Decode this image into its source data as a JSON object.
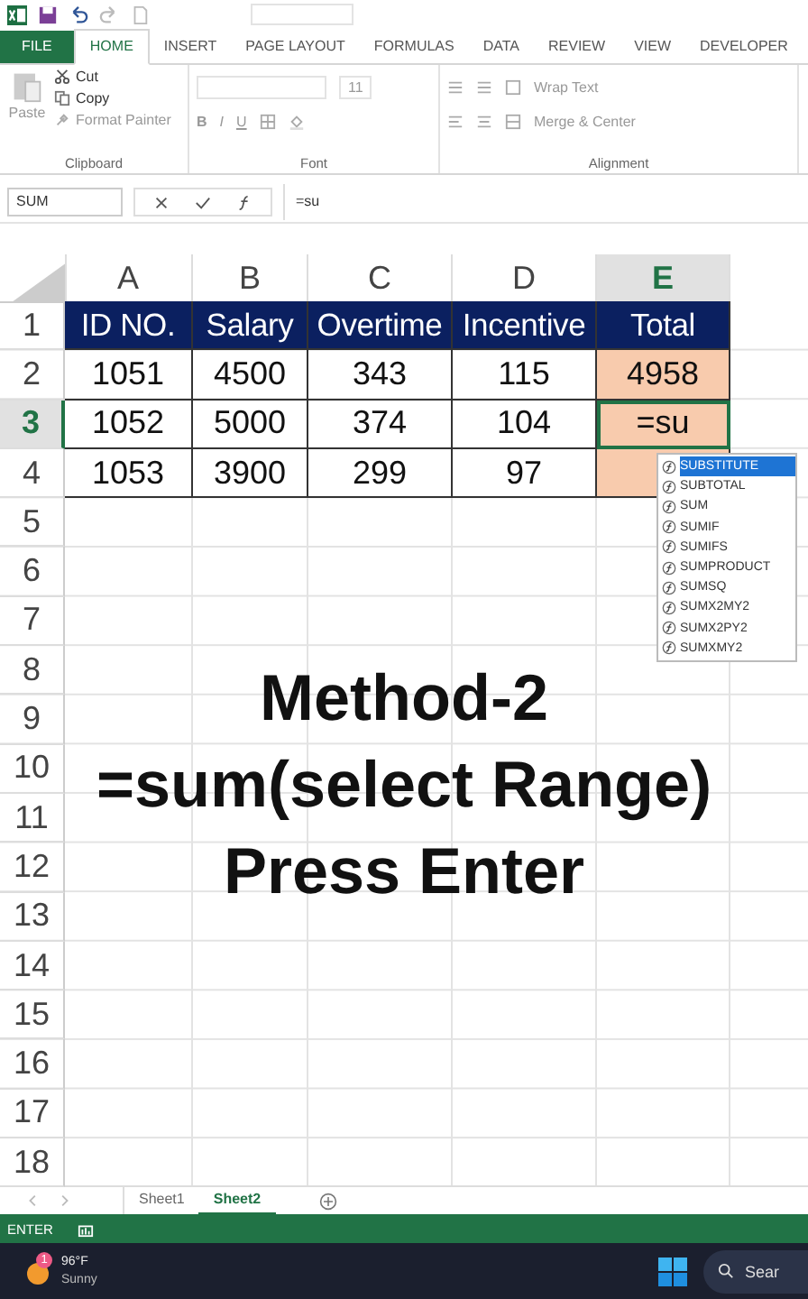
{
  "ribbon_tabs": [
    {
      "label": "FILE",
      "kind": "file",
      "selected": false
    },
    {
      "label": "HOME",
      "kind": "tab",
      "selected": true
    },
    {
      "label": "INSERT",
      "kind": "tab",
      "selected": false
    },
    {
      "label": "PAGE LAYOUT",
      "kind": "tab",
      "selected": false
    },
    {
      "label": "FORMULAS",
      "kind": "tab",
      "selected": false
    },
    {
      "label": "DATA",
      "kind": "tab",
      "selected": false
    },
    {
      "label": "REVIEW",
      "kind": "tab",
      "selected": false
    },
    {
      "label": "VIEW",
      "kind": "tab",
      "selected": false
    },
    {
      "label": "DEVELOPER",
      "kind": "tab",
      "selected": false
    }
  ],
  "clipboard": {
    "paste": "Paste",
    "cut": "Cut",
    "copy": "Copy",
    "format_painter": "Format Painter",
    "label": "Clipboard"
  },
  "font": {
    "size": "11",
    "bold": "B",
    "italic": "I",
    "underline": "U",
    "label": "Font"
  },
  "alignment": {
    "wrap_text": "Wrap Text",
    "merge_center": "Merge & Center",
    "label": "Alignment"
  },
  "name_box": "SUM",
  "formula": "=su",
  "columns": [
    {
      "letter": "A",
      "selected": false
    },
    {
      "letter": "B",
      "selected": false
    },
    {
      "letter": "C",
      "selected": false
    },
    {
      "letter": "D",
      "selected": false
    },
    {
      "letter": "E",
      "selected": true
    }
  ],
  "row_numbers": [
    {
      "label": "1",
      "selected": false
    },
    {
      "label": "2",
      "selected": false
    },
    {
      "label": "3",
      "selected": true
    },
    {
      "label": "4",
      "selected": false
    },
    {
      "label": "5",
      "selected": false
    },
    {
      "label": "6",
      "selected": false
    },
    {
      "label": "7",
      "selected": false
    },
    {
      "label": "8",
      "selected": false
    },
    {
      "label": "9",
      "selected": false
    },
    {
      "label": "10",
      "selected": false
    },
    {
      "label": "11",
      "selected": false
    },
    {
      "label": "12",
      "selected": false
    },
    {
      "label": "13",
      "selected": false
    },
    {
      "label": "14",
      "selected": false
    },
    {
      "label": "15",
      "selected": false
    },
    {
      "label": "16",
      "selected": false
    },
    {
      "label": "17",
      "selected": false
    },
    {
      "label": "18",
      "selected": false
    }
  ],
  "table": {
    "headers": [
      {
        "text": "ID NO.",
        "highlighted": false
      },
      {
        "text": "Salary",
        "highlighted": false
      },
      {
        "text": "Overtime",
        "highlighted": false
      },
      {
        "text": "Incentive",
        "highlighted": false
      },
      {
        "text": "Total",
        "highlighted": true
      }
    ],
    "rows": [
      [
        "1051",
        "4500",
        "343",
        "115",
        "4958"
      ],
      [
        "1052",
        "5000",
        "374",
        "104",
        "=su"
      ],
      [
        "1053",
        "3900",
        "299",
        "97"
      ]
    ]
  },
  "autocomplete": [
    {
      "label": "SUBSTITUTE",
      "selected": true
    },
    {
      "label": "SUBTOTAL",
      "selected": false
    },
    {
      "label": "SUM",
      "selected": false
    },
    {
      "label": "SUMIF",
      "selected": false
    },
    {
      "label": "SUMIFS",
      "selected": false
    },
    {
      "label": "SUMPRODUCT",
      "selected": false
    },
    {
      "label": "SUMSQ",
      "selected": false
    },
    {
      "label": "SUMX2MY2",
      "selected": false
    },
    {
      "label": "SUMX2PY2",
      "selected": false
    },
    {
      "label": "SUMXMY2",
      "selected": false
    }
  ],
  "overlay": [
    "Method-2",
    "=sum(select Range)",
    "Press Enter"
  ],
  "sheet_tabs": [
    {
      "label": "Sheet1",
      "selected": false
    },
    {
      "label": "Sheet2",
      "selected": true
    }
  ],
  "status": "ENTER",
  "taskbar": {
    "badge": "1",
    "temperature": "96°F",
    "condition": "Sunny",
    "search": "Sear"
  }
}
